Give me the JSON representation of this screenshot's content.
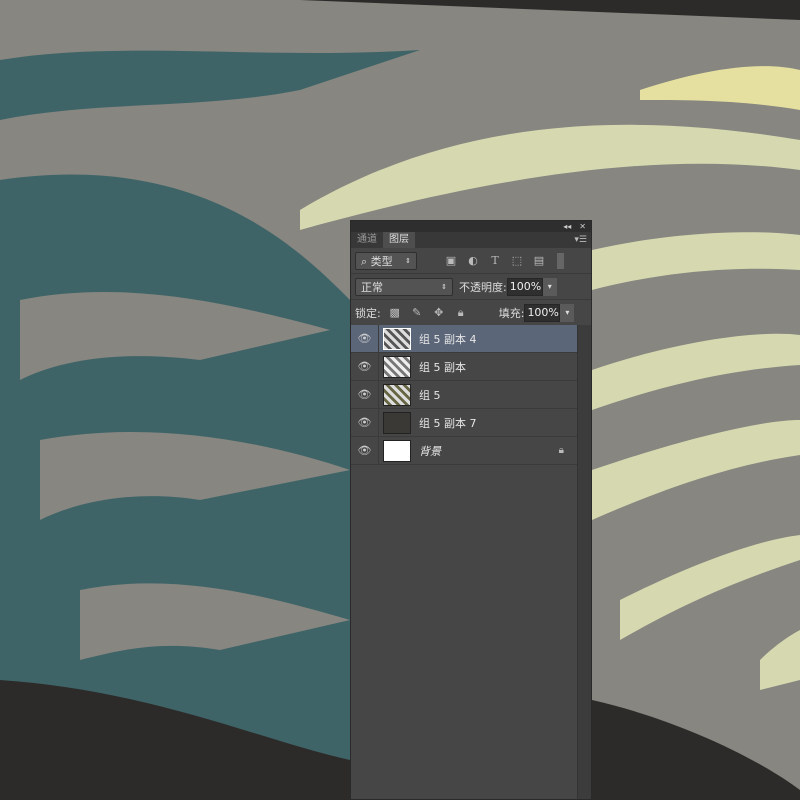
{
  "panel": {
    "controls": [
      "collapse",
      "close"
    ],
    "tabs": [
      {
        "label": "通道",
        "active": false
      },
      {
        "label": "图层",
        "active": true
      }
    ],
    "filter": {
      "label": "类型"
    },
    "blend_mode": "正常",
    "opacity_label": "不透明度:",
    "opacity": "100%",
    "lock_label": "锁定:",
    "fill_label": "填充:",
    "fill": "100%",
    "layers": [
      {
        "name": "组 5 副本 4",
        "selected": true
      },
      {
        "name": "组 5 副本",
        "selected": false
      },
      {
        "name": "组 5",
        "selected": false
      },
      {
        "name": "组 5 副本 7",
        "selected": false
      },
      {
        "name": "背景",
        "selected": false,
        "locked": true
      }
    ]
  },
  "colors": {
    "gray": "#878680",
    "teal": "#3f6467",
    "dark": "#2d2b29",
    "pale": "#d6d9b0",
    "selected": "#5b6679"
  }
}
